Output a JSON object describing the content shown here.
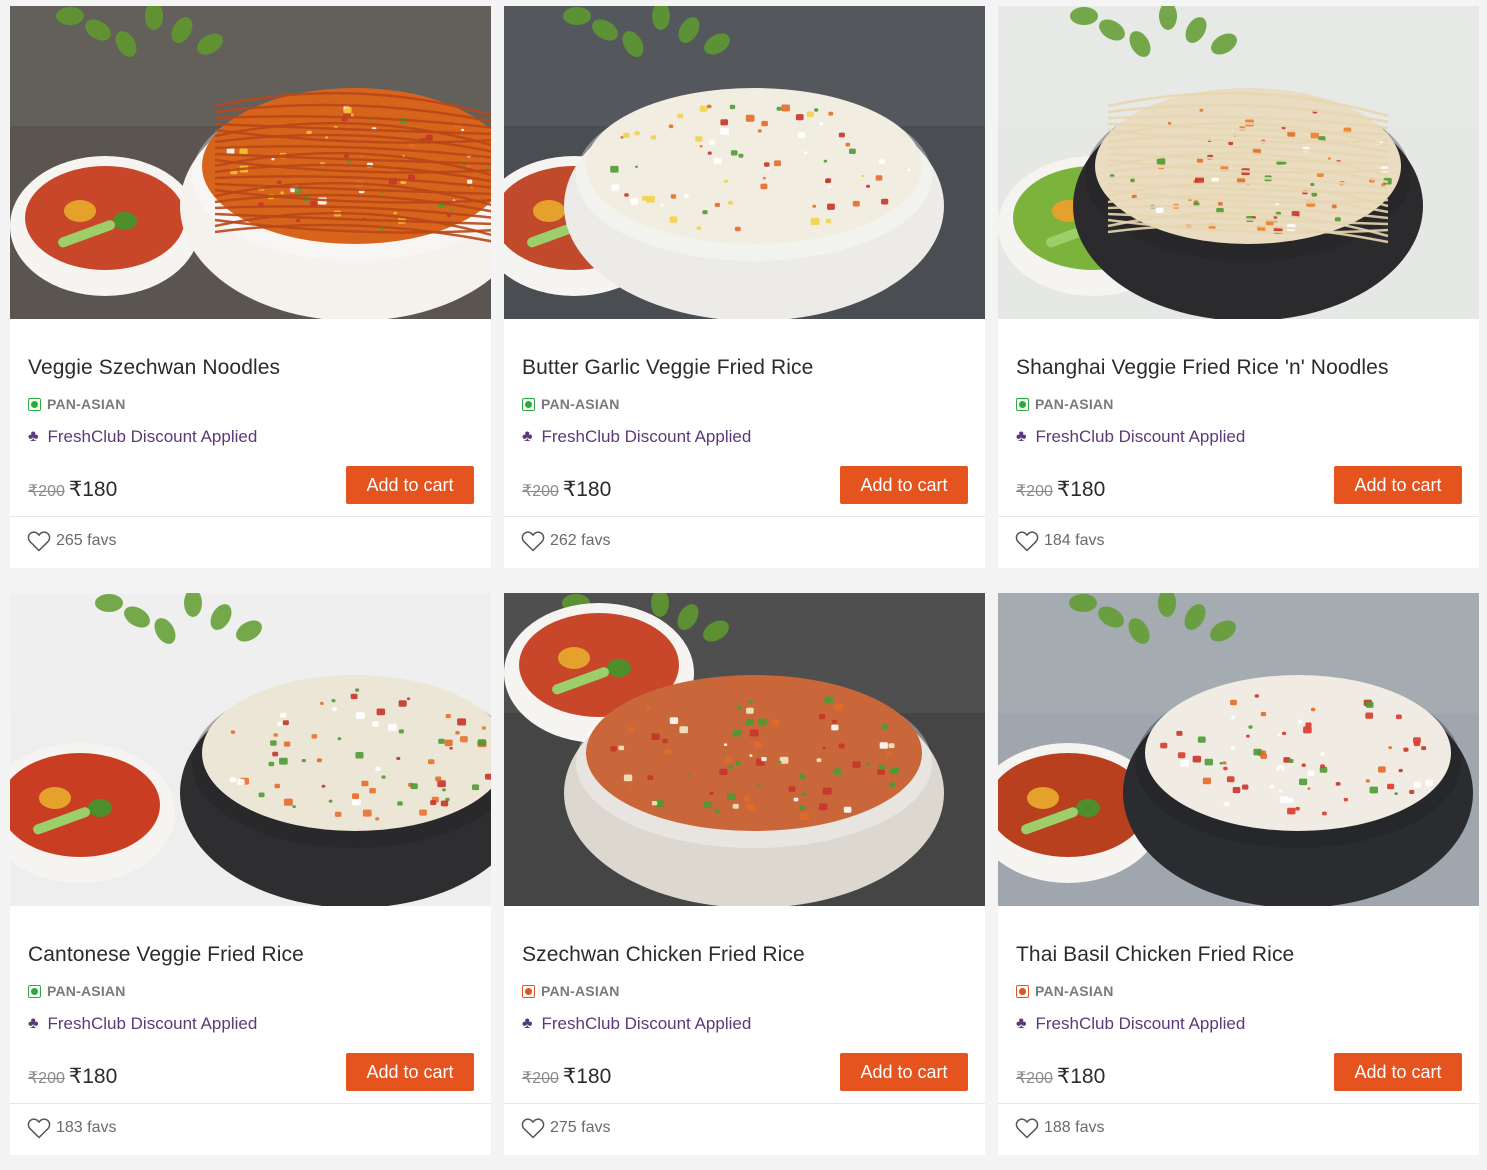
{
  "currency": "₹",
  "add_to_cart_label": "Add to cart",
  "club_label": "FreshClub Discount Applied",
  "products": [
    {
      "title": "Veggie Szechwan Noodles",
      "cuisine": "PAN-ASIAN",
      "diet": "veg",
      "old_price": "₹200",
      "price": "₹180",
      "favs": "265 favs",
      "image": "veggie-szechwan-noodles-photo",
      "palette": {
        "bg": "#5a5550",
        "bowl": "#f5f2ee",
        "food": "#d8641c",
        "accent": "#f2c230",
        "side": "#c8472a"
      }
    },
    {
      "title": "Butter Garlic Veggie Fried Rice",
      "cuisine": "PAN-ASIAN",
      "diet": "veg",
      "old_price": "₹200",
      "price": "₹180",
      "favs": "262 favs",
      "image": "butter-garlic-fried-rice-photo",
      "palette": {
        "bg": "#4a4d52",
        "bowl": "#ecebe7",
        "food": "#f1ede0",
        "accent": "#f2d24a",
        "side": "#c24a2c"
      }
    },
    {
      "title": "Shanghai Veggie Fried Rice 'n' Noodles",
      "cuisine": "PAN-ASIAN",
      "diet": "veg",
      "old_price": "₹200",
      "price": "₹180",
      "favs": "184 favs",
      "image": "shanghai-rice-noodles-photo",
      "palette": {
        "bg": "#e6e8e6",
        "bowl": "#2b2b2d",
        "food": "#e9dcc0",
        "accent": "#f07b2a",
        "side": "#7bb33c"
      }
    },
    {
      "title": "Cantonese Veggie Fried Rice",
      "cuisine": "PAN-ASIAN",
      "diet": "veg",
      "old_price": "₹200",
      "price": "₹180",
      "favs": "183 favs",
      "image": "cantonese-fried-rice-photo",
      "palette": {
        "bg": "#eeeeee",
        "bowl": "#2e2e30",
        "food": "#ece6d6",
        "accent": "#e8722c",
        "side": "#c93e22"
      }
    },
    {
      "title": "Szechwan Chicken Fried Rice",
      "cuisine": "PAN-ASIAN",
      "diet": "nonveg",
      "old_price": "₹200",
      "price": "₹180",
      "favs": "275 favs",
      "image": "szechwan-chicken-fried-rice-photo",
      "palette": {
        "bg": "#454545",
        "bowl": "#dcd8d0",
        "food": "#c9673a",
        "accent": "#f3e9c0",
        "side": "#c8472a"
      }
    },
    {
      "title": "Thai Basil Chicken Fried Rice",
      "cuisine": "PAN-ASIAN",
      "diet": "nonveg",
      "old_price": "₹200",
      "price": "₹180",
      "favs": "188 favs",
      "image": "thai-basil-fried-rice-photo",
      "palette": {
        "bg": "#9fa6ad",
        "bowl": "#2a2c30",
        "food": "#f0ece3",
        "accent": "#d83a2a",
        "side": "#b8401f"
      }
    }
  ]
}
